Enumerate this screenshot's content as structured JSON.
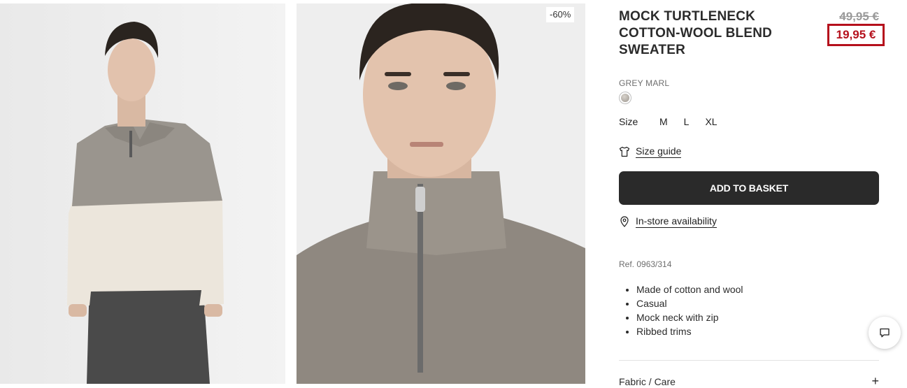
{
  "gallery": {
    "discount_badge": "-60%"
  },
  "product": {
    "title": "MOCK TURTLENECK COTTON-WOOL BLEND SWEATER",
    "old_price": "49,95 €",
    "new_price": "19,95 €",
    "color_name": "GREY MARL",
    "size_label": "Size",
    "sizes": [
      "M",
      "L",
      "XL"
    ],
    "size_guide_label": "Size guide",
    "add_to_basket_label": "ADD TO BASKET",
    "in_store_label": "In-store availability",
    "reference": "Ref. 0963/314",
    "features": [
      "Made of cotton and wool",
      "Casual",
      "Mock neck with zip",
      "Ribbed trims"
    ],
    "accordion_label": "Fabric / Care"
  },
  "colors": {
    "price_red": "#b5101c",
    "button_dark": "#2a2a2a"
  },
  "icons": {
    "size_guide": "t-shirt-icon",
    "in_store": "location-pin-icon",
    "chat": "chat-bubble-icon",
    "accordion": "plus-icon"
  }
}
